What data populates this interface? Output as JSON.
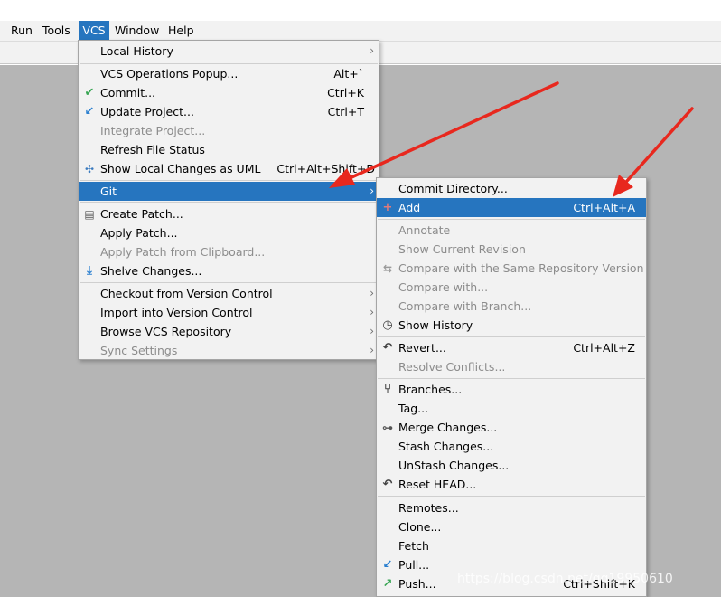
{
  "menubar": {
    "items": [
      {
        "label": "Run",
        "active": false
      },
      {
        "label": "Tools",
        "active": false
      },
      {
        "label": "VCS",
        "active": true
      },
      {
        "label": "Window",
        "active": false
      },
      {
        "label": "Help",
        "active": false
      }
    ]
  },
  "vcs_menu": {
    "items": [
      {
        "label": "Local History",
        "submenu": true
      },
      {
        "label": "VCS Operations Popup...",
        "shortcut": "Alt+`"
      },
      {
        "label": "Commit...",
        "shortcut": "Ctrl+K",
        "icon": "check-icon"
      },
      {
        "label": "Update Project...",
        "shortcut": "Ctrl+T",
        "icon": "update-arrow-icon"
      },
      {
        "label": "Integrate Project...",
        "disabled": true
      },
      {
        "label": "Refresh File Status"
      },
      {
        "label": "Show Local Changes as UML",
        "shortcut": "Ctrl+Alt+Shift+D",
        "icon": "uml-icon"
      },
      {
        "label": "Git",
        "submenu": true,
        "selected": true
      },
      {
        "label": "Create Patch...",
        "icon": "patch-icon"
      },
      {
        "label": "Apply Patch..."
      },
      {
        "label": "Apply Patch from Clipboard...",
        "disabled": true
      },
      {
        "label": "Shelve Changes...",
        "icon": "shelve-icon"
      },
      {
        "label": "Checkout from Version Control",
        "submenu": true
      },
      {
        "label": "Import into Version Control",
        "submenu": true
      },
      {
        "label": "Browse VCS Repository",
        "submenu": true
      },
      {
        "label": "Sync Settings",
        "submenu": true,
        "disabled": true
      }
    ]
  },
  "git_menu": {
    "items": [
      {
        "label": "Commit Directory..."
      },
      {
        "label": "Add",
        "shortcut": "Ctrl+Alt+A",
        "selected": true,
        "icon": "plus-icon"
      },
      {
        "label": "Annotate",
        "disabled": true
      },
      {
        "label": "Show Current Revision",
        "disabled": true
      },
      {
        "label": "Compare with the Same Repository Version",
        "disabled": true,
        "icon": "compare-icon"
      },
      {
        "label": "Compare with...",
        "disabled": true
      },
      {
        "label": "Compare with Branch...",
        "disabled": true
      },
      {
        "label": "Show History",
        "icon": "history-clock-icon"
      },
      {
        "label": "Revert...",
        "shortcut": "Ctrl+Alt+Z",
        "icon": "revert-icon"
      },
      {
        "label": "Resolve Conflicts...",
        "disabled": true
      },
      {
        "label": "Branches...",
        "icon": "branch-icon"
      },
      {
        "label": "Tag..."
      },
      {
        "label": "Merge Changes...",
        "icon": "merge-icon"
      },
      {
        "label": "Stash Changes..."
      },
      {
        "label": "UnStash Changes..."
      },
      {
        "label": "Reset HEAD...",
        "icon": "reset-icon"
      },
      {
        "label": "Remotes..."
      },
      {
        "label": "Clone..."
      },
      {
        "label": "Fetch"
      },
      {
        "label": "Pull...",
        "icon": "pull-arrow-icon"
      },
      {
        "label": "Push...",
        "shortcut": "Ctrl+Shift+K",
        "icon": "push-arrow-icon"
      }
    ]
  },
  "colors": {
    "selection": "#2675bf",
    "menu_bg": "#f2f2f2",
    "workspace": "#b5b5b5",
    "annotation_arrow": "#e8281e",
    "check": "#3aa655",
    "update": "#2a7fd0"
  },
  "watermark": "https://blog.csdn.net/qq19950610"
}
